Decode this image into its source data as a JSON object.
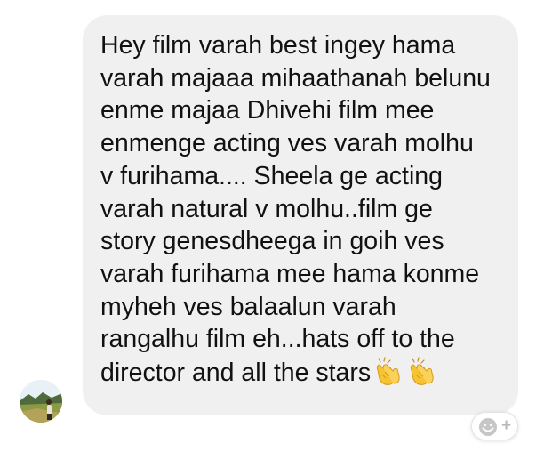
{
  "message": {
    "lines": [
      "Hey film varah best ingey hama",
      "varah majaaa mihaathanah belunu",
      "enme majaa Dhivehi film mee",
      "enmenge acting ves varah molhu",
      "v furihama.... Sheela ge acting",
      "varah natural v molhu..film ge",
      "story genesdheega in goih ves",
      "varah furihama mee hama konme",
      "myheh ves balaalun varah",
      "rangalhu film eh...hats off to the",
      "director and all the stars"
    ],
    "emoji": [
      "clapping-hands-icon",
      "clapping-hands-icon"
    ]
  },
  "sender": {
    "avatar": "avatar-photo"
  },
  "reaction_button": {
    "icon": "smiley-icon",
    "plus": "+"
  },
  "colors": {
    "bubble_bg": "#f0f0f0",
    "text": "#111111",
    "emoji_yellow": "#f7c331"
  }
}
